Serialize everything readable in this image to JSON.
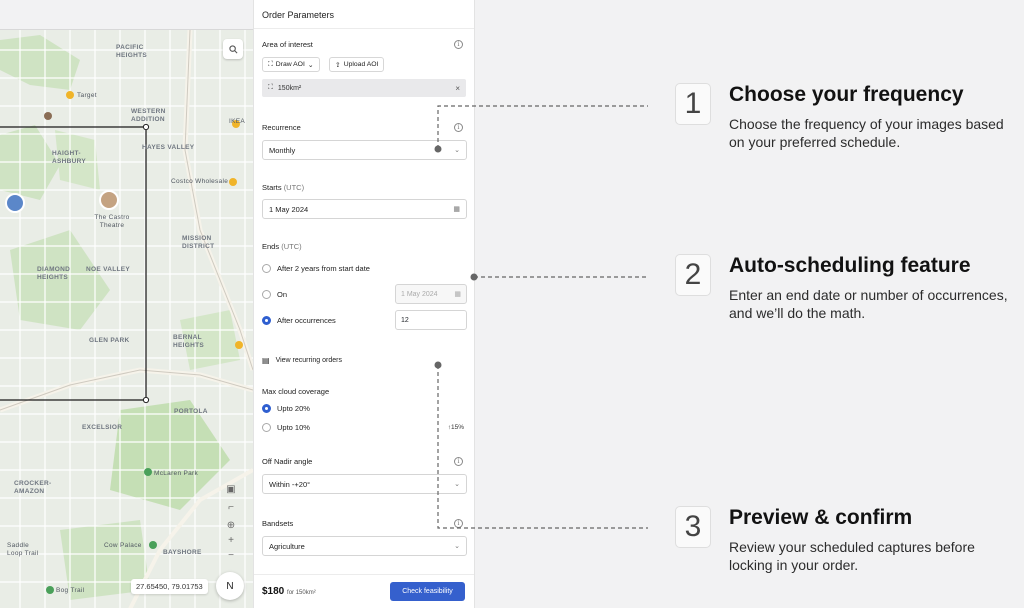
{
  "map": {
    "labels": [
      {
        "text": "PACIFIC HEIGHTS",
        "kind": "district"
      },
      {
        "text": "WESTERN ADDITION",
        "kind": "district"
      },
      {
        "text": "HAYES VALLEY",
        "kind": "district"
      },
      {
        "text": "HAIGHT-ASHBURY",
        "kind": "district"
      },
      {
        "text": "MISSION DISTRICT",
        "kind": "district"
      },
      {
        "text": "NOE VALLEY",
        "kind": "district"
      },
      {
        "text": "DIAMOND HEIGHTS",
        "kind": "district"
      },
      {
        "text": "GLEN PARK",
        "kind": "district"
      },
      {
        "text": "BERNAL HEIGHTS",
        "kind": "district"
      },
      {
        "text": "PORTOLA",
        "kind": "district"
      },
      {
        "text": "EXCELSIOR",
        "kind": "district"
      },
      {
        "text": "CROCKER-AMAZON",
        "kind": "district"
      },
      {
        "text": "BAYSHORE",
        "kind": "district"
      },
      {
        "text": "Target",
        "kind": "poi"
      },
      {
        "text": "IKEA",
        "kind": "poi"
      },
      {
        "text": "Costco Wholesale",
        "kind": "poi"
      },
      {
        "text": "The Castro Theatre",
        "kind": "poi"
      },
      {
        "text": "McLaren Park",
        "kind": "poi"
      },
      {
        "text": "Cow Palace",
        "kind": "poi"
      },
      {
        "text": "Saddle Loop Trail",
        "kind": "poi"
      },
      {
        "text": "Bog Trail",
        "kind": "poi"
      }
    ],
    "coords": "27.65450, 79.01753",
    "compass": "N"
  },
  "panel": {
    "title": "Order Parameters",
    "aoi": {
      "label": "Area of interest",
      "draw_btn": "Draw AOI",
      "upload_btn": "Upload AOI",
      "chip": "150km²"
    },
    "recurrence": {
      "label": "Recurrence",
      "value": "Monthly"
    },
    "starts": {
      "label": "Starts",
      "unit": "(UTC)",
      "value": "1 May 2024"
    },
    "ends": {
      "label": "Ends",
      "unit": "(UTC)",
      "opt1": "After 2 years from start date",
      "opt2": "On",
      "opt2_value": "1 May 2024",
      "opt3": "After occurrences",
      "opt3_value": "12"
    },
    "view_orders": "View recurring orders",
    "cloud": {
      "label": "Max cloud coverage",
      "opt1": "Upto 20%",
      "opt2": "Upto 10%",
      "delta": "↑15%"
    },
    "nadir": {
      "label": "Off Nadir angle",
      "value": "Within -+20°"
    },
    "bandsets": {
      "label": "Bandsets",
      "value": "Agriculture"
    },
    "footer": {
      "price": "$180",
      "price_sub": "for 150km²",
      "cta": "Check feasibility"
    }
  },
  "features": [
    {
      "num": "1",
      "title": "Choose your frequency",
      "desc": "Choose the frequency of your images based on your preferred schedule."
    },
    {
      "num": "2",
      "title": "Auto-scheduling feature",
      "desc": "Enter an end date or number of occurrences, and we’ll do the math."
    },
    {
      "num": "3",
      "title": "Preview & confirm",
      "desc": "Review your scheduled captures before locking in your order."
    }
  ]
}
